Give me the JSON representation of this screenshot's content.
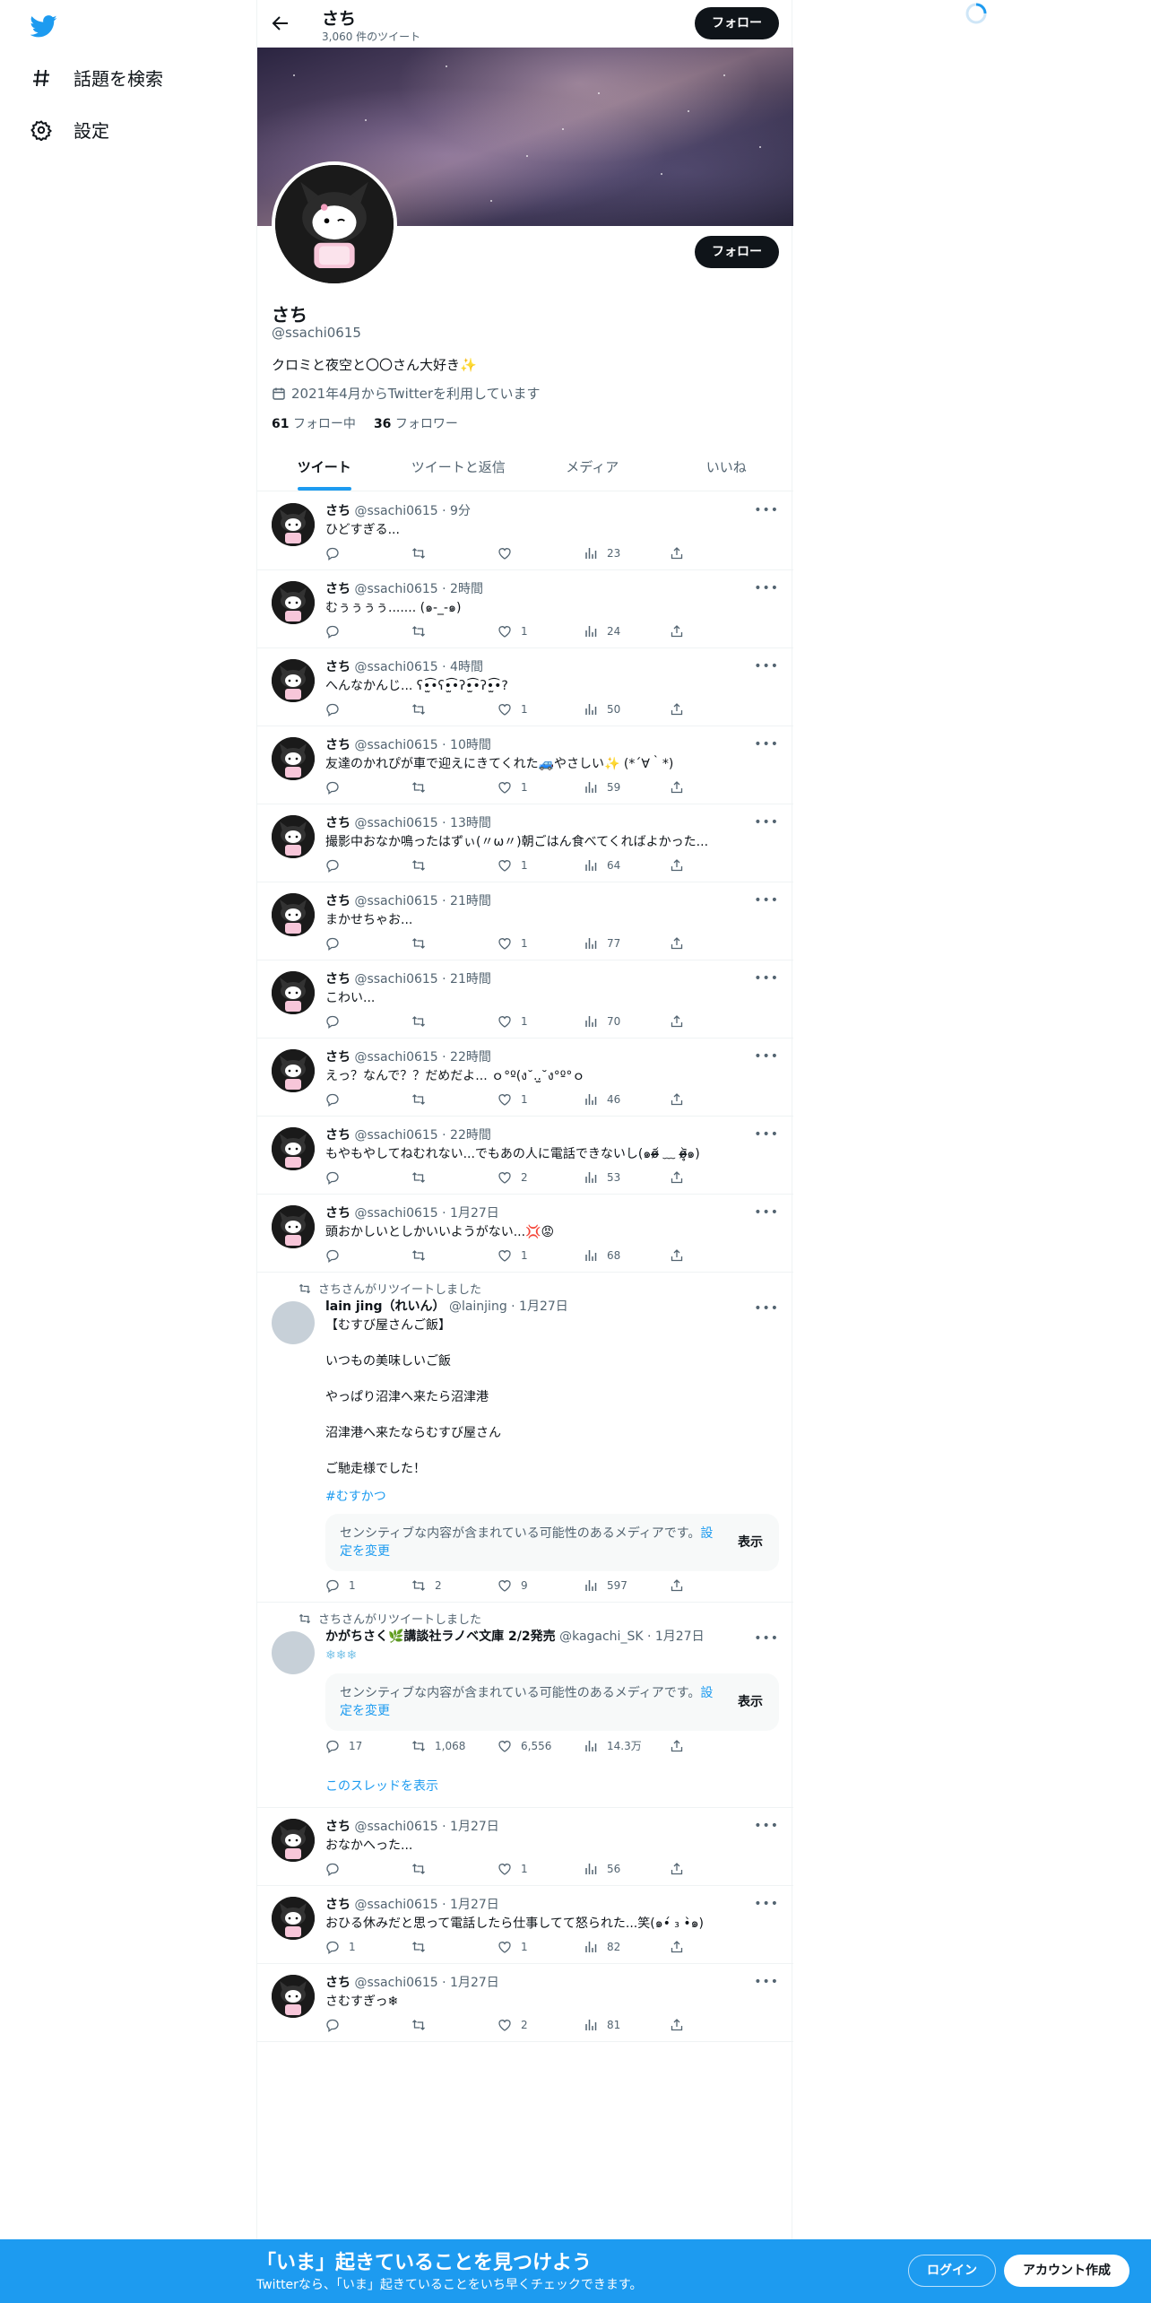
{
  "nav": {
    "items": [
      {
        "label": "話題を検索",
        "icon": "hashtag-icon"
      },
      {
        "label": "設定",
        "icon": "gear-icon"
      }
    ]
  },
  "header": {
    "name": "さち",
    "tweet_count": "3,060 件のツイート",
    "follow_label": "フォロー"
  },
  "profile": {
    "name": "さち",
    "handle": "@ssachi0615",
    "bio": "クロミと夜空と〇〇さん大好き✨",
    "joined": "2021年4月からTwitterを利用しています",
    "following_count": "61",
    "following_label": "フォロー中",
    "followers_count": "36",
    "followers_label": "フォロワー",
    "follow_label": "フォロー"
  },
  "tabs": [
    "ツイート",
    "ツイートと返信",
    "メディア",
    "いいね"
  ],
  "tweets": [
    {
      "name": "さち",
      "meta": "@ssachi0615 · 9分",
      "text": "ひどすぎる...",
      "reply": "",
      "retweet": "",
      "like": "",
      "views": "23"
    },
    {
      "name": "さち",
      "meta": "@ssachi0615 · 2時間",
      "text": "むぅぅぅぅ....... (๑-_-๑)",
      "reply": "",
      "retweet": "",
      "like": "1",
      "views": "24"
    },
    {
      "name": "さち",
      "meta": "@ssachi0615 · 4時間",
      "text": "へんなかんじ... ʕ•̫͡•ʕ•̫͡•ʔ•̫͡•ʔ•̫͡•?",
      "reply": "",
      "retweet": "",
      "like": "1",
      "views": "50"
    },
    {
      "name": "さち",
      "meta": "@ssachi0615 · 10時間",
      "text": "友達のかれぴが車で迎えにきてくれた🚙やさしい✨ (*´∀｀*)",
      "reply": "",
      "retweet": "",
      "like": "1",
      "views": "59"
    },
    {
      "name": "さち",
      "meta": "@ssachi0615 · 13時間",
      "text": "撮影中おなか鳴ったはずぃ(〃ω〃)朝ごはん食べてくればよかった...",
      "reply": "",
      "retweet": "",
      "like": "1",
      "views": "64"
    },
    {
      "name": "さち",
      "meta": "@ssachi0615 · 21時間",
      "text": "まかせちゃお...",
      "reply": "",
      "retweet": "",
      "like": "1",
      "views": "77"
    },
    {
      "name": "さち",
      "meta": "@ssachi0615 · 21時間",
      "text": "こわい...",
      "reply": "",
      "retweet": "",
      "like": "1",
      "views": "70"
    },
    {
      "name": "さち",
      "meta": "@ssachi0615 · 22時間",
      "text": "えっ？なんで？？だめだよ... ｏ°º(ง˘..̫˘ง°º°ｏ",
      "reply": "",
      "retweet": "",
      "like": "1",
      "views": "46"
    },
    {
      "name": "さち",
      "meta": "@ssachi0615 · 22時間",
      "text": "もやもやしてねむれない...でもあの人に電話できないし(๑o̴̶̷᷄ ﹏ o̴̶̷̥᷅๑)",
      "reply": "",
      "retweet": "",
      "like": "2",
      "views": "53"
    },
    {
      "name": "さち",
      "meta": "@ssachi0615 · 1月27日",
      "text": "頭おかしいとしかいいようがない...💢😡",
      "reply": "",
      "retweet": "",
      "like": "1",
      "views": "68"
    }
  ],
  "retweet1": {
    "label": "さちさんがリツイートしました",
    "name": "lain jing（れいん）",
    "meta": "@lainjing · 1月27日",
    "text": "【むすび屋さんご飯】\n\nいつもの美味しいご飯\n\nやっぱり沼津へ来たら沼津港\n\n沼津港へ来たならむすび屋さん\n\nご馳走様でした！",
    "hashtag": "#むすかつ",
    "sensitive_text": "センシティブな内容が含まれている可能性のあるメディアです。",
    "sensitive_link": "設定を変更",
    "show_label": "表示",
    "reply": "1",
    "retweet": "2",
    "like": "9",
    "views": "597"
  },
  "retweet2": {
    "label": "さちさんがリツイートしました",
    "name": "かがちさく🌿講談社ラノベ文庫 2/2発売",
    "meta": "@kagachi_SK · 1月27日",
    "text": "❄❄❄",
    "sensitive_text": "センシティブな内容が含まれている可能性のあるメディアです。",
    "sensitive_link": "設定を変更",
    "show_label": "表示",
    "reply": "17",
    "retweet": "1,068",
    "like": "6,556",
    "views": "14.3万",
    "thread_link": "このスレッドを表示"
  },
  "tweets2": [
    {
      "name": "さち",
      "meta": "@ssachi0615 · 1月27日",
      "text": "おなかへった...",
      "reply": "",
      "retweet": "",
      "like": "1",
      "views": "56"
    },
    {
      "name": "さち",
      "meta": "@ssachi0615 · 1月27日",
      "text": "おひる休みだと思って電話したら仕事してて怒られた...笑(๑•́ ₃ •̀๑)",
      "reply": "1",
      "retweet": "",
      "like": "1",
      "views": "82"
    },
    {
      "name": "さち",
      "meta": "@ssachi0615 · 1月27日",
      "text": "さむすぎっ❄",
      "reply": "",
      "retweet": "",
      "like": "2",
      "views": "81"
    }
  ],
  "bottom": {
    "title": "「いま」起きていることを見つけよう",
    "subtitle": "Twitterなら、「いま」起きていることをいち早くチェックできます。",
    "login": "ログイン",
    "signup": "アカウント作成"
  },
  "colors": {
    "accent": "#1d9bf0",
    "text": "#0f1419",
    "secondary": "#536471"
  }
}
